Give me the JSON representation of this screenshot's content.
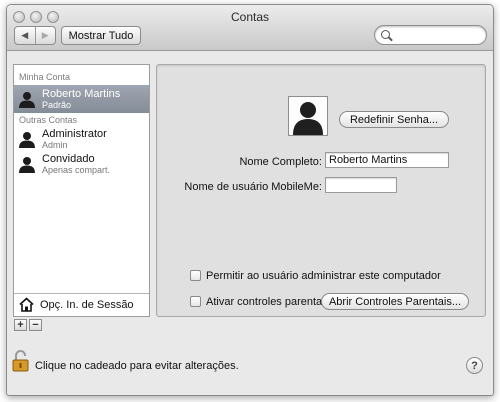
{
  "window": {
    "title": "Contas"
  },
  "toolbar": {
    "back_icon": "◀",
    "forward_icon": "▶",
    "show_all_label": "Mostrar Tudo",
    "search_value": ""
  },
  "sidebar": {
    "my_account_label": "Minha Conta",
    "other_accounts_label": "Outras Contas",
    "accounts": [
      {
        "name": "Roberto Martins",
        "role": "Padrão",
        "selected": true
      },
      {
        "name": "Administrator",
        "role": "Admin",
        "selected": false
      },
      {
        "name": "Convidado",
        "role": "Apenas compart.",
        "selected": false
      }
    ],
    "login_options_label": "Opç. In. de Sessão"
  },
  "list_controls": {
    "add_label": "+",
    "remove_label": "−"
  },
  "detail": {
    "reset_password_label": "Redefinir Senha...",
    "full_name_label": "Nome Completo:",
    "full_name_value": "Roberto Martins",
    "mobileme_label": "Nome de usuário MobileMe:",
    "mobileme_value": "",
    "allow_admin_label": "Permitir ao usuário administrar este computador",
    "allow_admin_checked": false,
    "parental_controls_label": "Ativar controles parentais",
    "parental_controls_checked": false,
    "open_parental_label": "Abrir Controles Parentais..."
  },
  "footer": {
    "lock_text": "Clique no cadeado para evitar alterações.",
    "help_label": "?"
  },
  "colors": {
    "selection": "#8c939e",
    "window_bg": "#e9e9e9",
    "panel_bg": "#e0e0e0"
  }
}
